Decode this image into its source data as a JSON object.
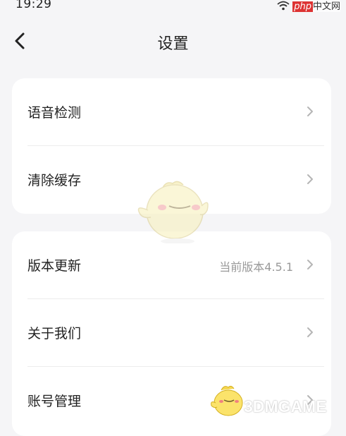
{
  "status_bar": {
    "time": "19:29",
    "watermark_text": "中文网",
    "watermark_brand": "php"
  },
  "header": {
    "title": "设置"
  },
  "settings_groups": [
    {
      "items": [
        {
          "label": "语音检测",
          "value": ""
        },
        {
          "label": "清除缓存",
          "value": ""
        }
      ]
    },
    {
      "items": [
        {
          "label": "版本更新",
          "value": "当前版本4.5.1"
        },
        {
          "label": "关于我们",
          "value": ""
        },
        {
          "label": "账号管理",
          "value": ""
        }
      ]
    }
  ],
  "watermark_bottom": "3DMGAME",
  "icons": {
    "back": "chevron-left-icon",
    "row_arrow": "chevron-right-icon",
    "wifi": "wifi-icon"
  },
  "colors": {
    "background": "#f5f5f7",
    "card": "#ffffff",
    "text_primary": "#222222",
    "text_secondary": "#9a9a9a",
    "chevron": "#b5b5b5"
  }
}
